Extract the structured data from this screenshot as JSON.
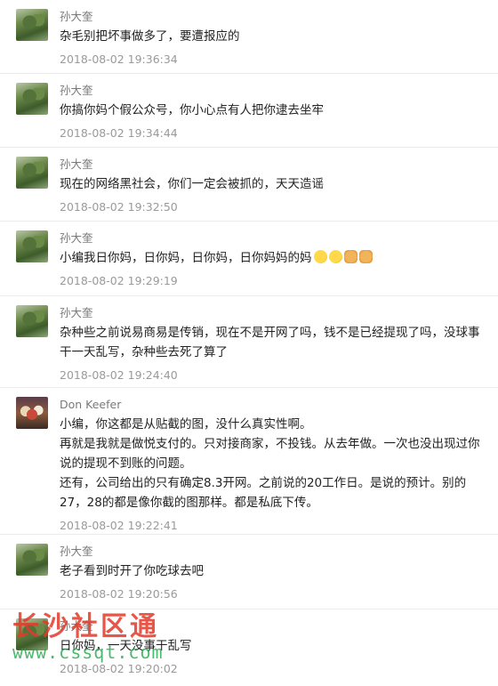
{
  "comments": [
    {
      "author": "孙大奎",
      "text": "杂毛别把坏事做多了，要遭报应的",
      "time": "2018-08-02 19:36:34"
    },
    {
      "author": "孙大奎",
      "text": "你搞你妈个假公众号，你小心点有人把你逮去坐牢",
      "time": "2018-08-02 19:34:44"
    },
    {
      "author": "孙大奎",
      "text": "现在的网络黑社会，你们一定会被抓的，天天造谣",
      "time": "2018-08-02 19:32:50"
    },
    {
      "author": "孙大奎",
      "text": "小编我日你妈，日你妈，日你妈，日你妈妈的妈",
      "time": "2018-08-02 19:29:19",
      "emojis": [
        "thinking-face",
        "thinking-face",
        "fist",
        "fist"
      ]
    },
    {
      "author": "孙大奎",
      "text": "杂种些之前说易商易是传销，现在不是开网了吗，钱不是已经提现了吗，没球事干一天乱写，杂种些去死了算了",
      "time": "2018-08-02 19:24:40"
    },
    {
      "author": "Don Keefer",
      "text_lines": [
        "小编，你这都是从贴截的图，没什么真实性啊。",
        "再就是我就是做悦支付的。只对接商家，不投钱。从去年做。一次也没出现过你说的提现不到账的问题。",
        "还有，公司给出的只有确定8.3开网。之前说的20工作日。是说的预计。别的27，28的都是像你截的图那样。都是私底下传。"
      ],
      "time": "2018-08-02 19:22:41"
    },
    {
      "author": "孙大奎",
      "text": "老子看到时开了你吃球去吧",
      "time": "2018-08-02 19:20:56"
    },
    {
      "author": "孙大奎",
      "text": "日你妈，一天没事干乱写",
      "time": "2018-08-02 19:20:02"
    }
  ],
  "watermark": {
    "title": "长沙社区通",
    "url": "www.cssqt.com"
  }
}
